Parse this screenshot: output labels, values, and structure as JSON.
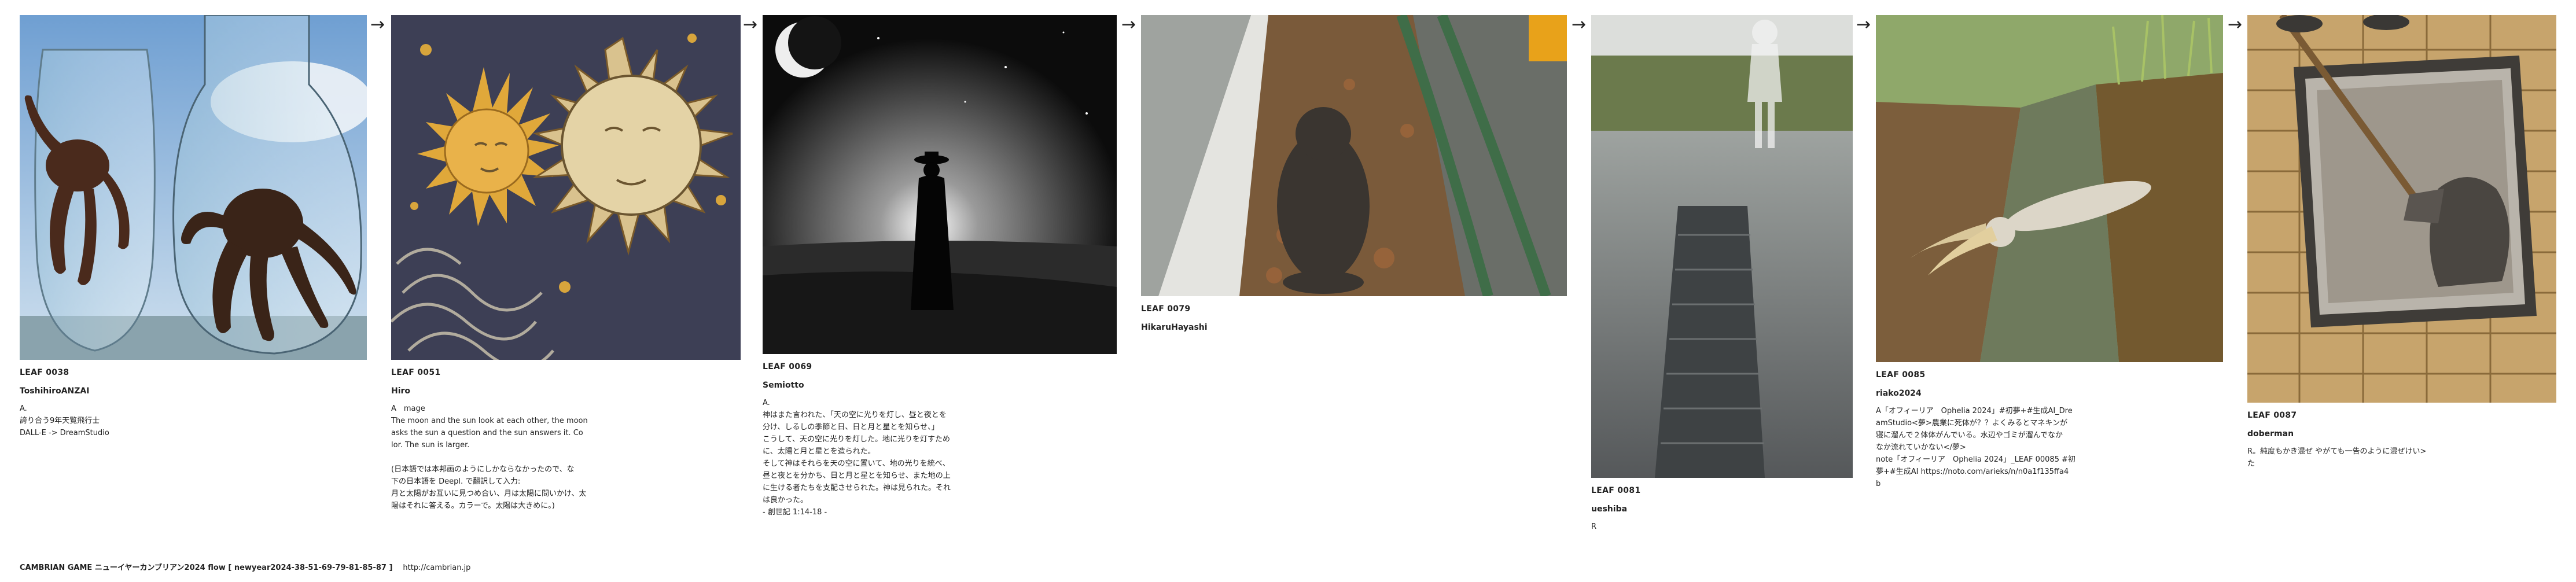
{
  "leaves": [
    {
      "id": "LEAF 0038",
      "author": "ToshihiroANZAI",
      "text": "A.\n誇り合う9年天覧飛行士\nDALL-E -> DreamStudio"
    },
    {
      "id": "LEAF 0051",
      "author": "Hiro",
      "text": "A　mage\nThe moon and the sun look at each other, the moon\nasks the sun a question and the sun answers it. Co\nlor. The sun is larger.\n\n(日本語では本邦画のようにしかならなかったので、な\n下の日本語を Deepl. で翻訳して入力:\n月と太陽がお互いに見つめ合い、月は太陽に問いかけ、太\n陽はそれに答える。カラーで。太陽は大きめに。)"
    },
    {
      "id": "LEAF 0069",
      "author": "Semiotto",
      "text": "A.\n神はまた言われた、「天の空に光りを灯し、昼と夜とを\n分け、しるしの季節と日、日と月と星とを知らせ、」\nこうして、天の空に光りを灯した。地に光りを灯すため\nに、太陽と月と星とを造られた。\nそして神はそれらを天の空に置いて、地の光りを統べ、\n昼と夜とを分かち、日と月と星とを知らせ、また地の上\nに生ける者たちを支配させられた。神は見られた。それ\nは良かった。\n- 創世記 1:14-18 -"
    },
    {
      "id": "LEAF 0079",
      "author": "HikaruHayashi",
      "text": ""
    },
    {
      "id": "LEAF 0081",
      "author": "ueshiba",
      "text": "R"
    },
    {
      "id": "LEAF 0085",
      "author": "riako2024",
      "text": "A「オフィーリア　Ophelia 2024」#初夢+#生成AI_Dre\namStudio<夢>農業に死体が？？よくみるとマネキンが\n寝に溜んで２体体がんでいる。水辺やゴミが溜んでなか\nなか流れていかない</夢>\nnote「オフィーリア　Ophelia 2024」_LEAF 00085 #初\n夢+#生成AI https://noto.com/arieks/n/n0a1f135ffa4\nb"
    },
    {
      "id": "LEAF 0087",
      "author": "doberman",
      "text": "R。純度もかき混ぜ やがても一告のように混ぜけい>\nた"
    }
  ],
  "arrow": "→",
  "footer": {
    "title": "CAMBRIAN GAME  ニューイヤーカンブリアン2024  flow [ newyear2024-38-51-69-79-81-85-87 ]",
    "url": "http://cambrian.jp"
  }
}
